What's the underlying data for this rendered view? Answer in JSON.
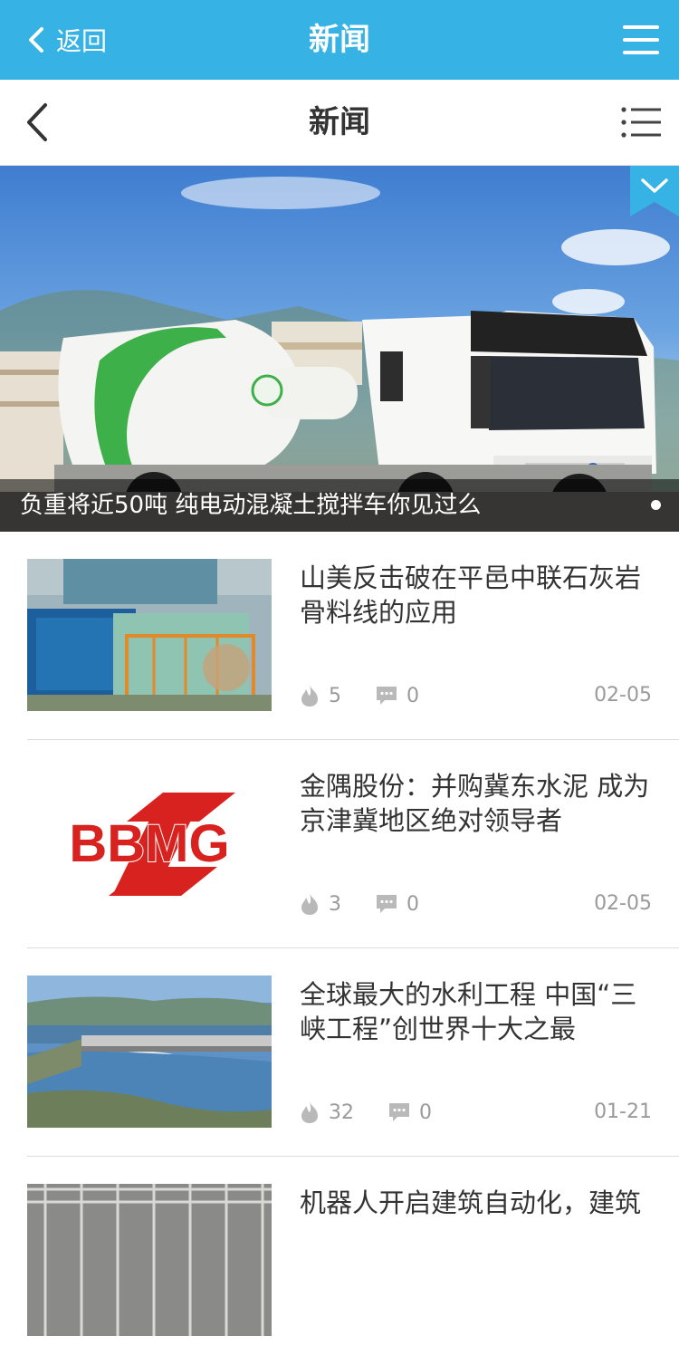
{
  "app_bar": {
    "back_label": "返回",
    "title": "新闻",
    "background": "#36b2e4"
  },
  "sub_header": {
    "title": "新闻"
  },
  "banner": {
    "caption": "负重将近50吨 纯电动混凝土搅拌车你见过么",
    "image_subject": "white electric concrete mixer truck with green drum under blue sky"
  },
  "news": [
    {
      "title": "山美反击破在平邑中联石灰岩骨料线的应用",
      "views": "5",
      "comments": "0",
      "date": "02-05",
      "thumb": "crushing plant machinery"
    },
    {
      "title": "金隅股份：并购冀东水泥 成为京津冀地区绝对领导者",
      "views": "3",
      "comments": "0",
      "date": "02-05",
      "thumb": "BBMG logo",
      "logo_text": "BBMG"
    },
    {
      "title": "全球最大的水利工程 中国“三峡工程”创世界十大之最",
      "views": "32",
      "comments": "0",
      "date": "01-21",
      "thumb": "Three Gorges dam aerial view"
    },
    {
      "title": "机器人开启建筑自动化，建筑",
      "thumb": "steel rebar structure"
    }
  ],
  "colors": {
    "accent": "#36b2e4",
    "meta_text": "#9a9a9a",
    "logo_red": "#d7221f"
  },
  "icons": [
    "chevron-left-icon",
    "hamburger-menu-icon",
    "list-menu-icon",
    "chevron-down-icon",
    "flame-icon",
    "comment-icon"
  ]
}
